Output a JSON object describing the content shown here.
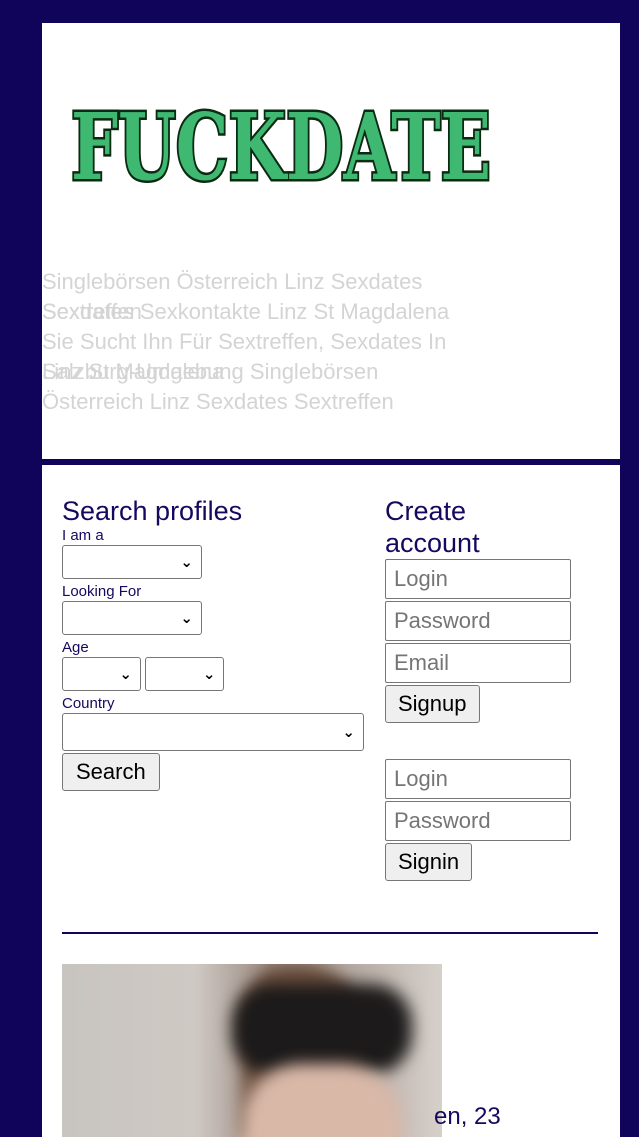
{
  "logo": {
    "text": "FUCKDATE",
    "fill": "#3fb871",
    "stroke": "#0b2a12"
  },
  "tagline": {
    "line1": "Singlebörsen Österreich Linz Sexdates",
    "line2a": "Sextreffen",
    "line2b": "Sexdates Sexkontakte Linz St Magdalena",
    "line3": "Sie Sucht Ihn Für Sextreffen, Sexdates In",
    "line4a": "Linz St Magdalena",
    "line4b": "Salzburg-Umgebung Singlebörsen",
    "line5": "Österreich Linz Sexdates Sextreffen"
  },
  "search": {
    "title": "Search profiles",
    "iam_label": "I am a",
    "looking_label": "Looking For",
    "age_label": "Age",
    "country_label": "Country",
    "button": "Search"
  },
  "account": {
    "title_line1": "Create",
    "title_line2": "account",
    "signup_login_placeholder": "Login",
    "signup_password_placeholder": "Password",
    "signup_email_placeholder": "Email",
    "signup_button": "Signup",
    "signin_login_placeholder": "Login",
    "signin_password_placeholder": "Password",
    "signin_button": "Signin"
  },
  "profile": {
    "caption": "en, 23"
  },
  "colors": {
    "frame": "#10045a",
    "text": "#15095f",
    "tagline": "#d4d4d4"
  }
}
